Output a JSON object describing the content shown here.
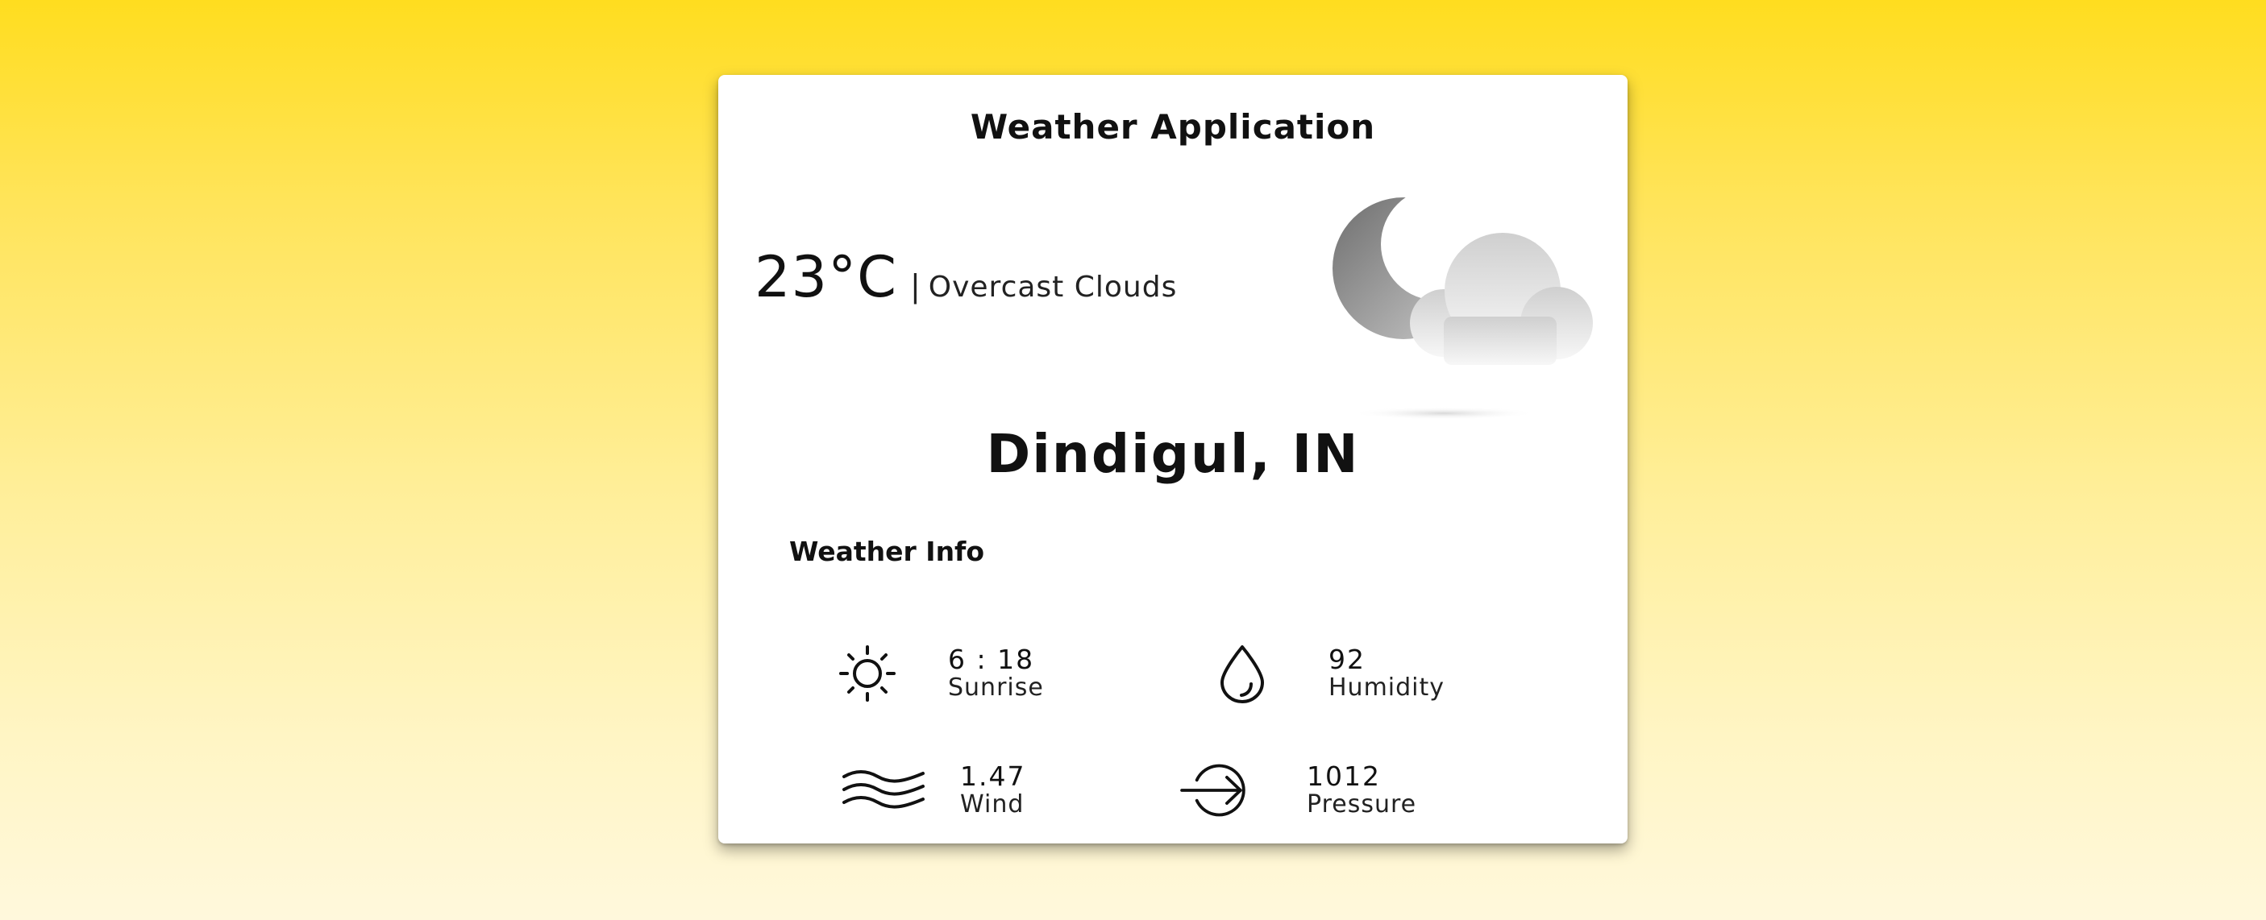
{
  "app": {
    "title": "Weather Application"
  },
  "current": {
    "temperature": "23°C",
    "separator": "|",
    "description": "Overcast Clouds",
    "icon": "moon-cloud-icon"
  },
  "location": {
    "city": "Dindigul, IN"
  },
  "info": {
    "title": "Weather Info",
    "items": [
      {
        "value": "6 : 18",
        "label": "Sunrise",
        "icon": "sun-icon"
      },
      {
        "value": "92",
        "label": "Humidity",
        "icon": "droplet-icon"
      },
      {
        "value": "1.47",
        "label": "Wind",
        "icon": "wind-icon"
      },
      {
        "value": "1012",
        "label": "Pressure",
        "icon": "arrow-in-circle-icon"
      }
    ]
  },
  "colors": {
    "background_top": "#ffdd1f",
    "background_bottom": "#fff8dc",
    "card": "#ffffff",
    "text": "#111111"
  }
}
